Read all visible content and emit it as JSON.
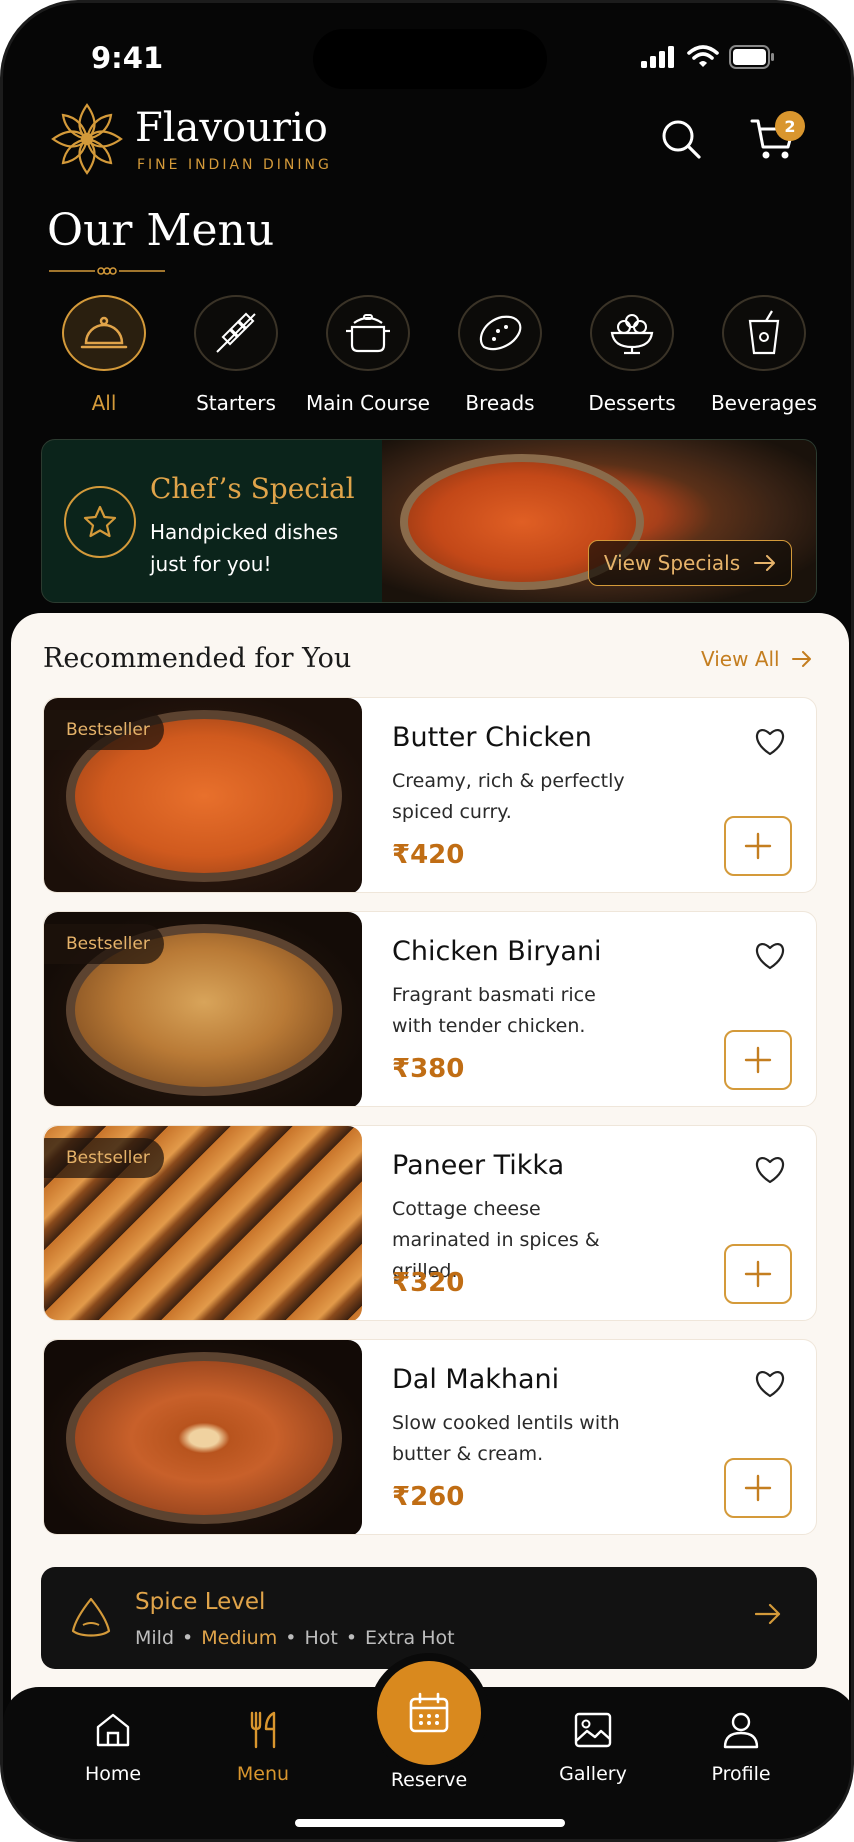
{
  "status_bar": {
    "time": "9:41"
  },
  "header": {
    "brand": "Flavourio",
    "tagline": "FINE INDIAN DINING",
    "cart_count": "2"
  },
  "page_title": "Our Menu",
  "categories": [
    {
      "label": "All",
      "icon": "cloche-icon",
      "active": true
    },
    {
      "label": "Starters",
      "icon": "skewer-icon"
    },
    {
      "label": "Main Course",
      "icon": "cooking-pot-icon"
    },
    {
      "label": "Breads",
      "icon": "bread-icon"
    },
    {
      "label": "Desserts",
      "icon": "dessert-bowl-icon"
    },
    {
      "label": "Beverages",
      "icon": "cup-icon"
    }
  ],
  "banner": {
    "title": "Chef’s Special",
    "subtitle": "Handpicked dishes just for you!",
    "button": "View Specials"
  },
  "recommended": {
    "title": "Recommended for You",
    "view_all": "View All",
    "items": [
      {
        "name": "Butter Chicken",
        "desc": "Creamy, rich & perfectly spiced curry.",
        "price": "₹420",
        "badge": "Bestseller"
      },
      {
        "name": "Chicken Biryani",
        "desc": "Fragrant basmati rice with tender chicken.",
        "price": "₹380",
        "badge": "Bestseller"
      },
      {
        "name": "Paneer Tikka",
        "desc": "Cottage cheese marinated in spices & grilled.",
        "price": "₹320",
        "badge": "Bestseller"
      },
      {
        "name": "Dal Makhani",
        "desc": "Slow cooked lentils with butter & cream.",
        "price": "₹260",
        "badge": ""
      }
    ]
  },
  "spice": {
    "title": "Spice Level",
    "levels": [
      "Mild",
      "Medium",
      "Hot",
      "Extra Hot"
    ],
    "selected": "Medium"
  },
  "tabs": {
    "home": "Home",
    "menu": "Menu",
    "reserve": "Reserve",
    "gallery": "Gallery",
    "profile": "Profile"
  },
  "colors": {
    "accent": "#d9962e",
    "background": "#060606",
    "sheet": "#fbf7f2",
    "banner": "#0b241b"
  }
}
